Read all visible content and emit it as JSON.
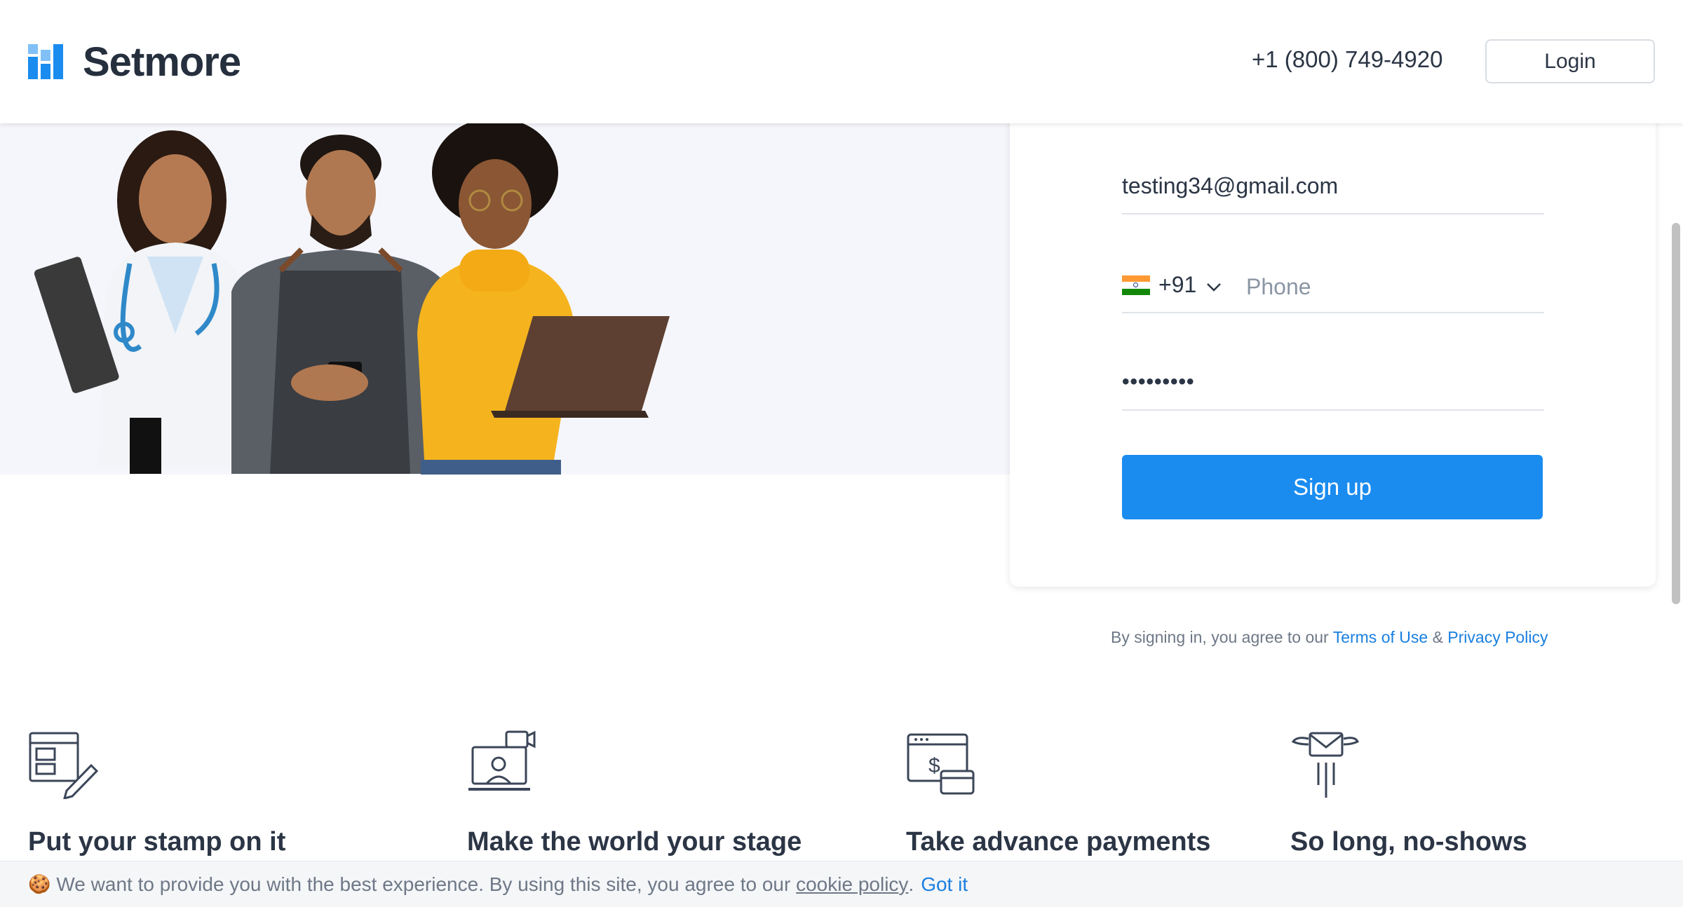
{
  "header": {
    "brand": "Setmore",
    "phone": "+1 (800) 749-4920",
    "login_label": "Login"
  },
  "signup": {
    "email_value": "testing34@gmail.com",
    "country_code": "+91",
    "country_flag": "India",
    "phone_placeholder": "Phone",
    "password_masked": "•••••••••",
    "signup_label": "Sign up"
  },
  "terms": {
    "prefix": "By signing in, you agree to our",
    "terms_link": "Terms of Use",
    "amp": "&",
    "privacy_link": "Privacy Policy"
  },
  "features": [
    {
      "title": "Put your stamp on it",
      "icon": "booking-page-edit-icon"
    },
    {
      "title": "Make the world your stage",
      "icon": "video-laptop-icon"
    },
    {
      "title": "Take advance payments",
      "icon": "payment-card-icon"
    },
    {
      "title": "So long, no-shows",
      "icon": "email-reminder-icon"
    }
  ],
  "cookie": {
    "emoji": "🍪",
    "text": "We want to provide you with the best experience. By using this site, you agree to our",
    "link": "cookie policy",
    "period": ".",
    "action": "Got it"
  },
  "colors": {
    "accent": "#1a8cf0",
    "text": "#2b3545",
    "hero_bg": "#f5f6fb",
    "yellow_sweater": "#f5b41e"
  }
}
